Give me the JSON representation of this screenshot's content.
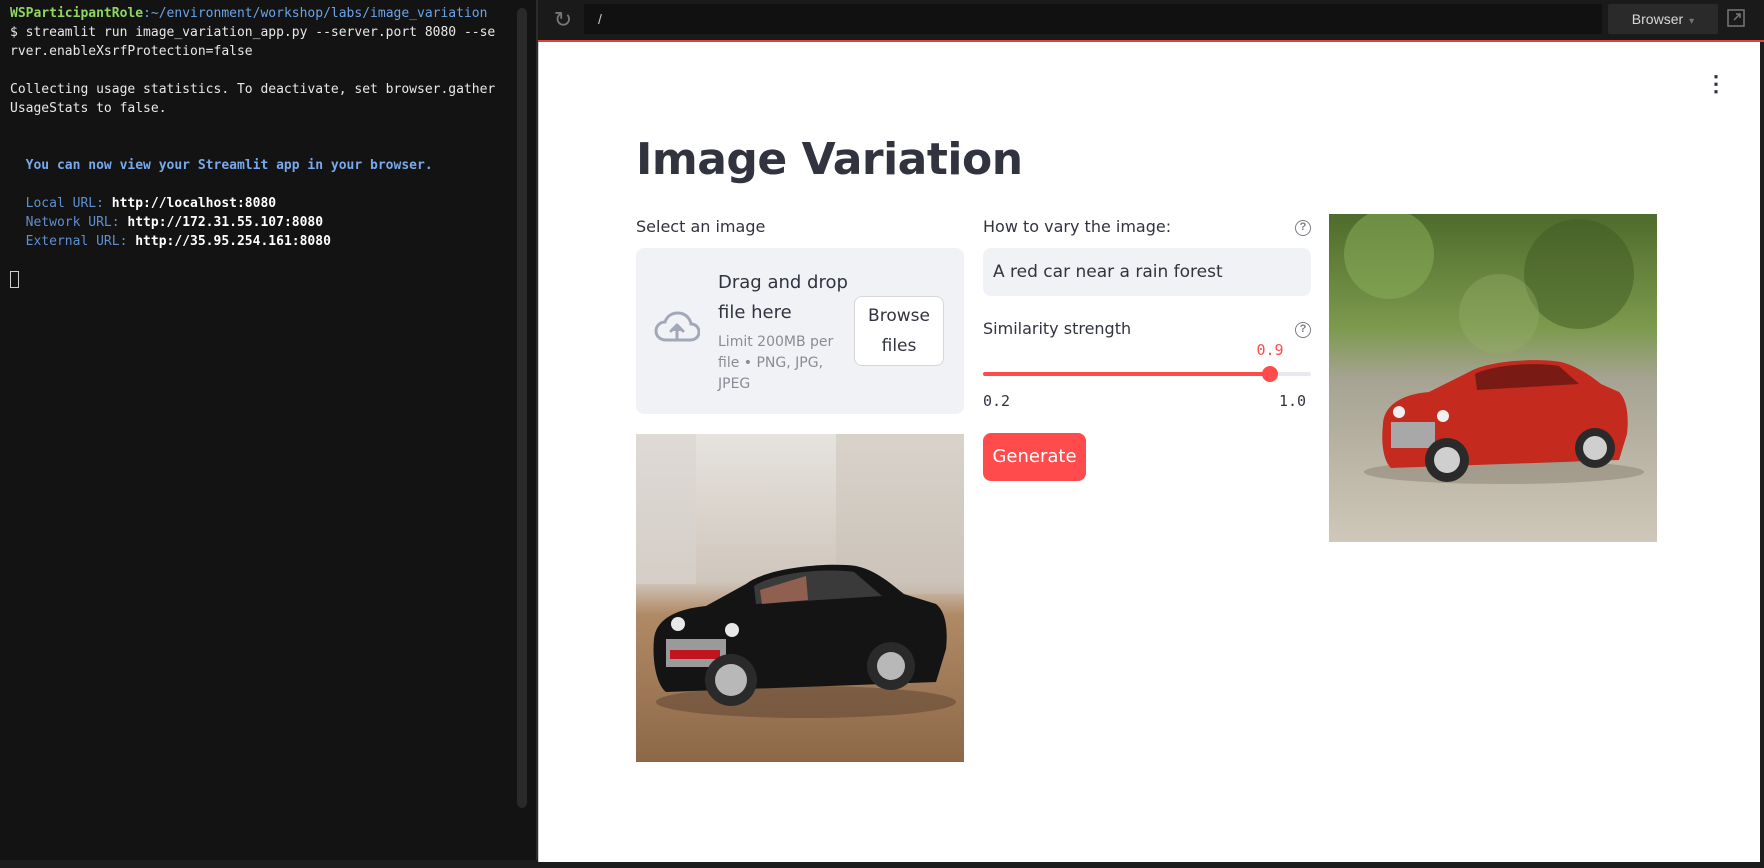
{
  "terminal": {
    "prompt_user": "WSParticipantRole",
    "prompt_path": ":~/environment/workshop/labs/image_variation",
    "command_line_1": "$ streamlit run image_variation_app.py --server.port 8080 --se",
    "command_line_2": "rver.enableXsrfProtection=false",
    "usage_line_1": "Collecting usage statistics. To deactivate, set browser.gather",
    "usage_line_2": "UsageStats to false.",
    "view_message": "  You can now view your Streamlit app in your browser.",
    "local_label": "  Local URL: ",
    "local_url": "http://localhost:8080",
    "network_label": "  Network URL: ",
    "network_url": "http://172.31.55.107:8080",
    "external_label": "  External URL: ",
    "external_url": "http://35.95.254.161:8080"
  },
  "browser": {
    "url": "/",
    "browser_button": "Browser"
  },
  "app": {
    "title": "Image Variation",
    "select_image_label": "Select an image",
    "uploader": {
      "drag_text": "Drag and drop file here",
      "limit_text": "Limit 200MB per file • PNG, JPG, JPEG",
      "browse_button": "Browse files"
    },
    "vary_label": "How to vary the image:",
    "vary_value": "A red car near a rain forest",
    "similarity_label": "Similarity strength",
    "slider": {
      "value": "0.9",
      "min": "0.2",
      "max": "1.0",
      "fraction": 0.875
    },
    "generate_button": "Generate"
  },
  "colors": {
    "accent": "#ff4b4b",
    "text": "#31333f",
    "input_bg": "#f0f2f6"
  }
}
